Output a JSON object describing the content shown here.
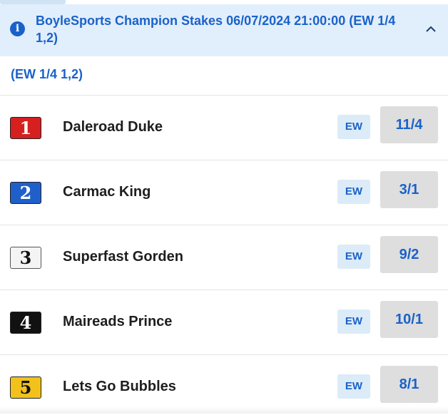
{
  "header": {
    "title": "BoyleSports Champion Stakes 06/07/2024 21:00:00 (EW 1/4 1,2)",
    "info_icon": "i"
  },
  "each_way_terms": "(EW 1/4 1,2)",
  "runners": [
    {
      "number": "1",
      "name": "Daleroad Duke",
      "ew_label": "EW",
      "odds": "11/4",
      "saddle_bg": "#d61f1f",
      "saddle_fg": "#ffffff"
    },
    {
      "number": "2",
      "name": "Carmac King",
      "ew_label": "EW",
      "odds": "3/1",
      "saddle_bg": "#1f5fc9",
      "saddle_fg": "#ffffff"
    },
    {
      "number": "3",
      "name": "Superfast Gorden",
      "ew_label": "EW",
      "odds": "9/2",
      "saddle_bg": "#f4f4f4",
      "saddle_fg": "#111111"
    },
    {
      "number": "4",
      "name": "Maireads Prince",
      "ew_label": "EW",
      "odds": "10/1",
      "saddle_bg": "#111111",
      "saddle_fg": "#ffffff"
    },
    {
      "number": "5",
      "name": "Lets Go Bubbles",
      "ew_label": "EW",
      "odds": "8/1",
      "saddle_bg": "#f2c21b",
      "saddle_fg": "#111111"
    }
  ],
  "colors": {
    "accent": "#1a62c9",
    "header_bg": "#e1eefb",
    "odds_bg": "#dedede",
    "ew_bg": "#dcebf8"
  }
}
